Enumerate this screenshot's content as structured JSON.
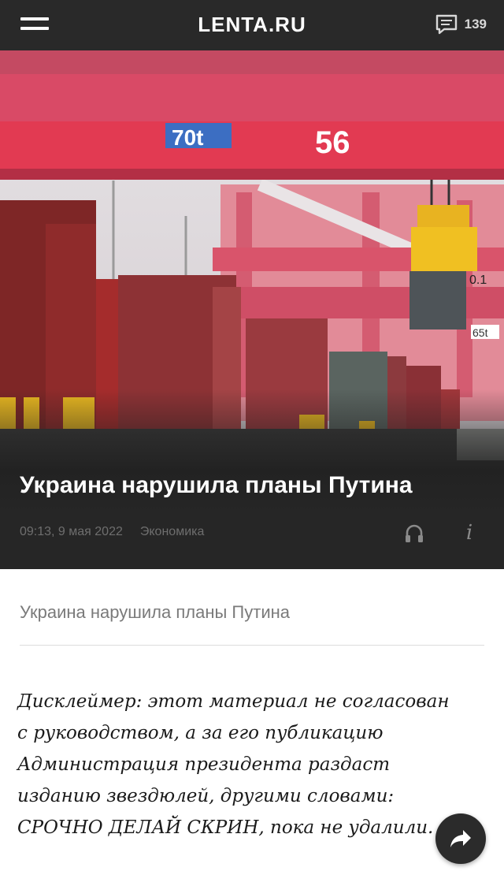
{
  "header": {
    "logo": "LENTA.RU",
    "comments_count": "139"
  },
  "article": {
    "headline": "Украина нарушила планы Путина",
    "time": "09:13, 9 мая 2022",
    "rubric": "Экономика",
    "subtitle": "Украина нарушила планы Путина",
    "body": "Дисклеймер: этот материал не согласован с руководством, а за его публикацию Администрация президента раздаст изданию звездюлей, другими словами: СРОЧНО ДЕЛАЙ СКРИН, пока не удалили."
  },
  "photo": {
    "crane_numbers": [
      "70t",
      "56"
    ],
    "container_labels": [
      "0.1",
      "65t"
    ]
  },
  "icons": {
    "menu": "hamburger-icon",
    "comments": "comment-icon",
    "listen": "headphones-icon",
    "info": "info-icon",
    "share": "share-arrow-icon"
  },
  "colors": {
    "topbar": "#292929",
    "hero_bottom": "#262626",
    "crane": "#d93a52",
    "share_button": "#2b2b2b"
  }
}
